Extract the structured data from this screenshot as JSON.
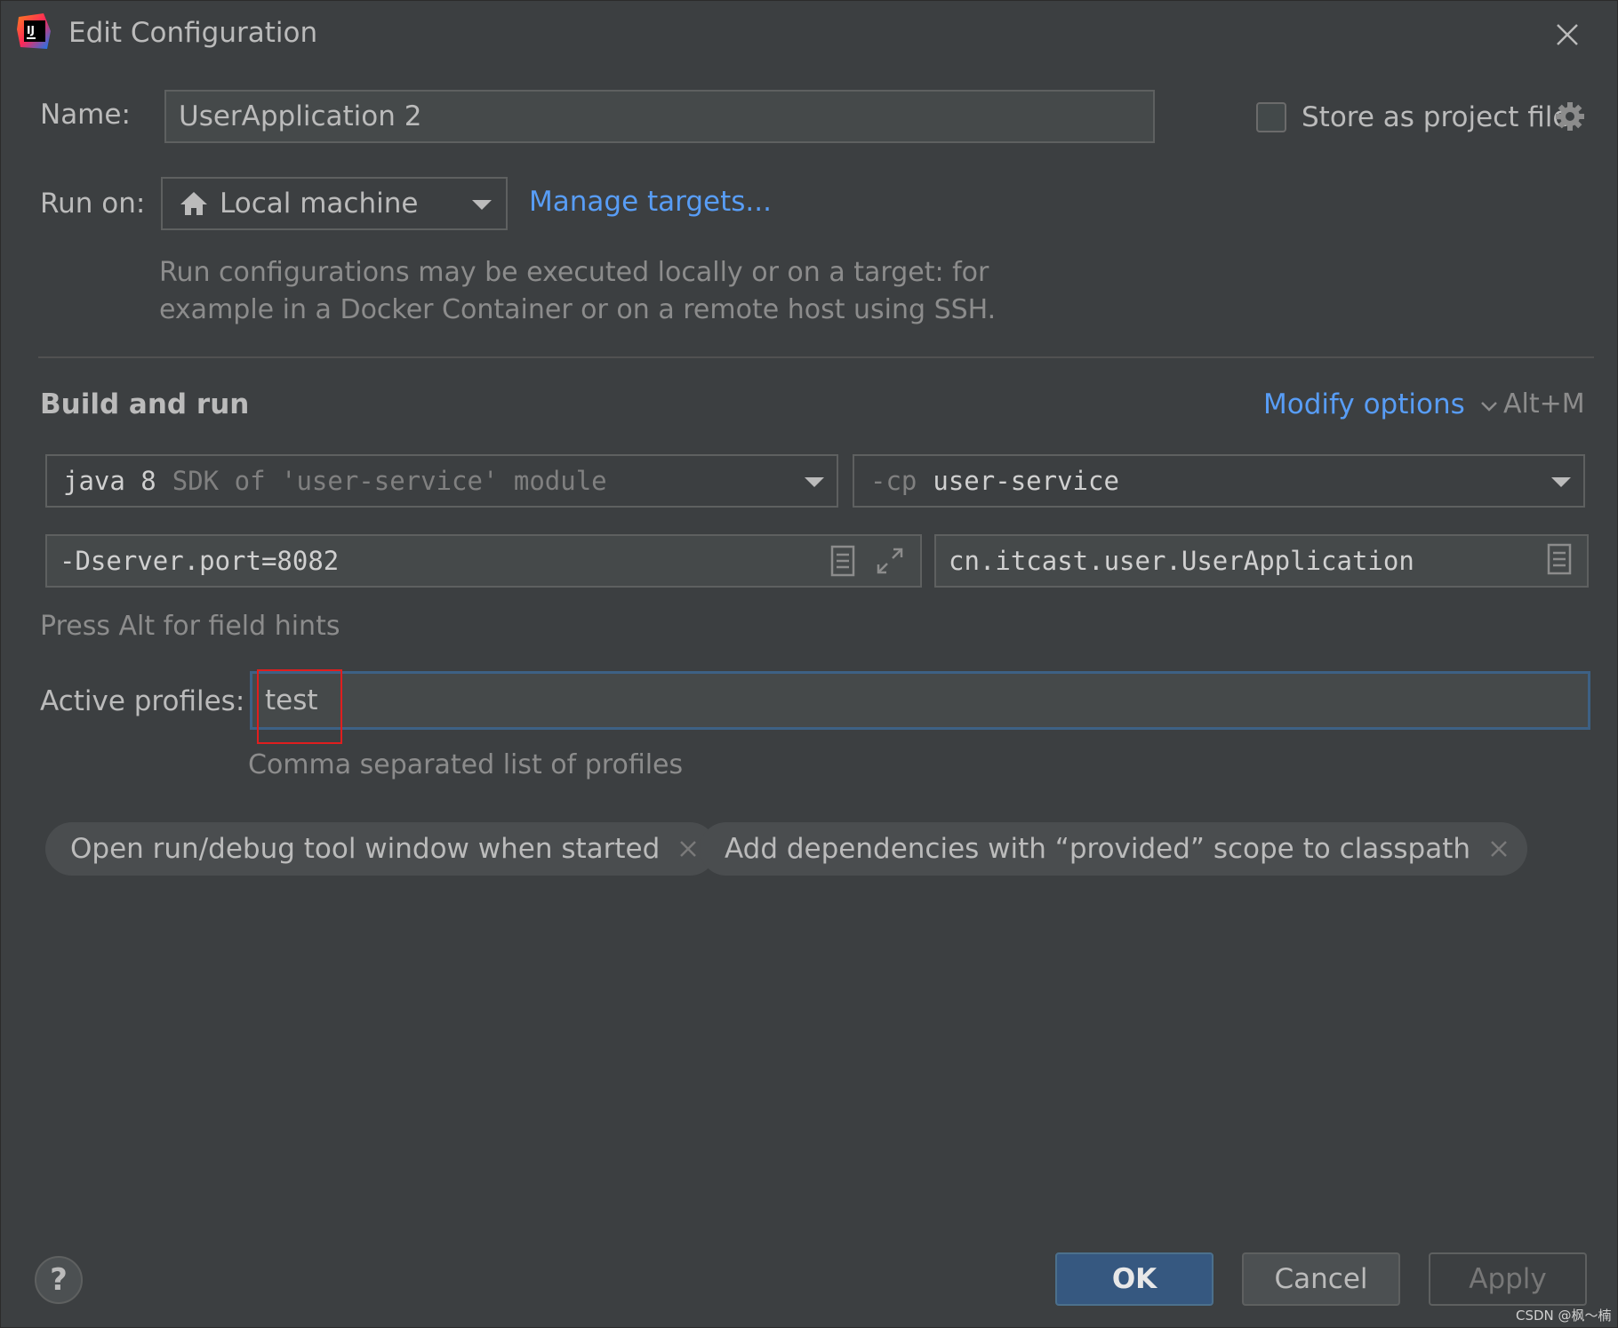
{
  "window": {
    "title": "Edit Configuration"
  },
  "name_row": {
    "label": "Name:",
    "value": "UserApplication 2"
  },
  "store_project": {
    "label": "Store as project file",
    "checked": false
  },
  "run_on": {
    "label": "Run on:",
    "selected": "Local machine",
    "manage_link": "Manage targets...",
    "hint_line1": "Run configurations may be executed locally or on a target: for",
    "hint_line2": "example in a Docker Container or on a remote host using SSH."
  },
  "build_run": {
    "title": "Build and run",
    "modify_options": "Modify options",
    "shortcut": "Alt+M",
    "jre_main": "java 8",
    "jre_detail": "SDK of 'user-service' module",
    "cp_prefix": "-cp",
    "cp_value": "user-service",
    "vm_options": "-Dserver.port=8082",
    "main_class": "cn.itcast.user.UserApplication",
    "field_hint": "Press Alt for field hints"
  },
  "profiles": {
    "label": "Active profiles:",
    "value": "test",
    "hint": "Comma separated list of profiles"
  },
  "chips": [
    {
      "label": "Open run/debug tool window when started"
    },
    {
      "label": "Add dependencies with “provided” scope to classpath"
    }
  ],
  "buttons": {
    "ok": "OK",
    "cancel": "Cancel",
    "apply": "Apply",
    "help": "?"
  },
  "watermark": "CSDN @枫～楠",
  "colors": {
    "background": "#3c3f41",
    "link": "#589df6",
    "accent_focus": "#3d6185",
    "ok_button": "#365880",
    "highlight_box": "#e01e1e"
  }
}
